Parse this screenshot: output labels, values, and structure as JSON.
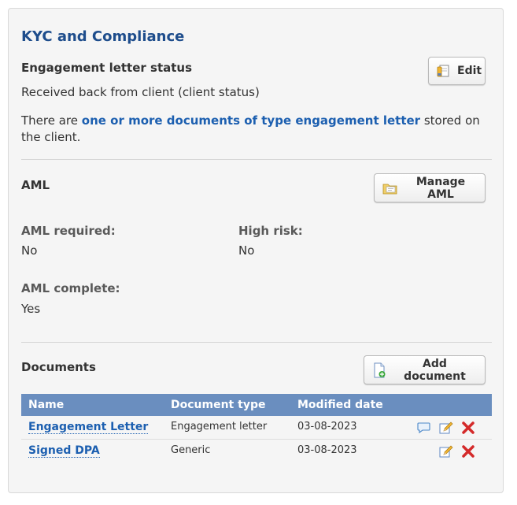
{
  "panel": {
    "title": "KYC and Compliance"
  },
  "engagement": {
    "heading": "Engagement letter status",
    "edit_label": "Edit",
    "status_text": "Received back from client (client status)",
    "docs_prefix": "There are ",
    "docs_link": "one or more documents of type engagement letter",
    "docs_suffix": " stored on the client."
  },
  "aml": {
    "heading": "AML",
    "manage_label": "Manage AML",
    "required_label": "AML required:",
    "required_value": "No",
    "high_risk_label": "High risk:",
    "high_risk_value": "No",
    "complete_label": "AML complete:",
    "complete_value": "Yes"
  },
  "documents": {
    "heading": "Documents",
    "add_label": "Add document",
    "columns": [
      "Name",
      "Document type",
      "Modified date"
    ],
    "rows": [
      {
        "name": "Engagement Letter",
        "type": "Engagement letter",
        "modified": "03-08-2023",
        "has_comment": true
      },
      {
        "name": "Signed DPA",
        "type": "Generic",
        "modified": "03-08-2023",
        "has_comment": false
      }
    ]
  },
  "colors": {
    "title": "#1e4d8c",
    "link": "#1c5fb0",
    "table_header": "#6a8ebf",
    "delete": "#d42a2a"
  },
  "icons": {
    "edit_button": "document-pencil-icon",
    "manage_aml": "folder-check-icon",
    "add_document": "document-add-icon",
    "comment": "speech-bubble-icon",
    "row_edit": "pencil-icon",
    "row_delete": "red-x-icon"
  }
}
